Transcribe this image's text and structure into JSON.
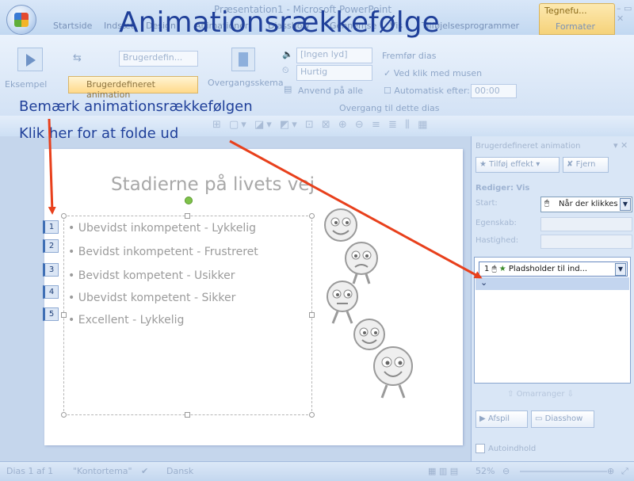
{
  "window": {
    "title": "Præsentation1 - Microsoft PowerPoint",
    "context_tab_group": "Tegnefu...",
    "context_tab": "Formater",
    "controls": "– ▭ ✕"
  },
  "tabs": [
    "Startside",
    "Indsæt",
    "Design",
    "Animationer",
    "Diasshow",
    "Gennemse",
    "Vis",
    "Tilføjelsesprogrammer"
  ],
  "ribbon": {
    "preview_label": "Eksempel",
    "animate_dropdown": "Brugerdefin...",
    "custom_animation_button": "Brugerdefineret animation",
    "transition_label": "Overgangsskema",
    "sound_dropdown": "[Ingen lyd]",
    "speed_dropdown": "Hurtig",
    "apply_all": "Anvend på alle",
    "advance_slide": "Fremfør dias",
    "on_mouse_click": "Ved klik med musen",
    "auto_after": "Automatisk efter:",
    "auto_after_value": "00:00",
    "group_label": "Overgang til dette dias"
  },
  "overlay": {
    "title": "Animationsrækkefølge",
    "note1": "Bemærk animationsrækkefølgen",
    "note2": "Klik her for at folde ud",
    "arrow_color": "#e8401c",
    "text_color": "#1f3f99"
  },
  "slide": {
    "title": "Stadierne på livets vej",
    "bullets": [
      "Ubevidst inkompetent - Lykkelig",
      "Bevidst inkompetent - Frustreret",
      "Bevidst kompetent - Usikker",
      "Ubevidst kompetent - Sikker",
      "Excellent - Lykkelig"
    ],
    "sequence_numbers": [
      "1",
      "2",
      "3",
      "4",
      "5"
    ]
  },
  "taskpane": {
    "title": "Brugerdefineret animation",
    "add_effect": "Tilføj effekt",
    "remove": "Fjern",
    "modify_label": "Rediger: Vis",
    "start_label": "Start:",
    "start_value": "Når der klikkes",
    "property_label": "Egenskab:",
    "speed_label": "Hastighed:",
    "list_item_number": "1",
    "list_item_text": "Pladsholder til ind...",
    "reorder": "Omarranger",
    "play": "Afspil",
    "slideshow": "Diasshow",
    "autopreview": "Autoindhold"
  },
  "status": {
    "slide_info": "Dias 1 af 1",
    "theme": "\"Kontortema\"",
    "language": "Dansk",
    "zoom": "52%"
  }
}
